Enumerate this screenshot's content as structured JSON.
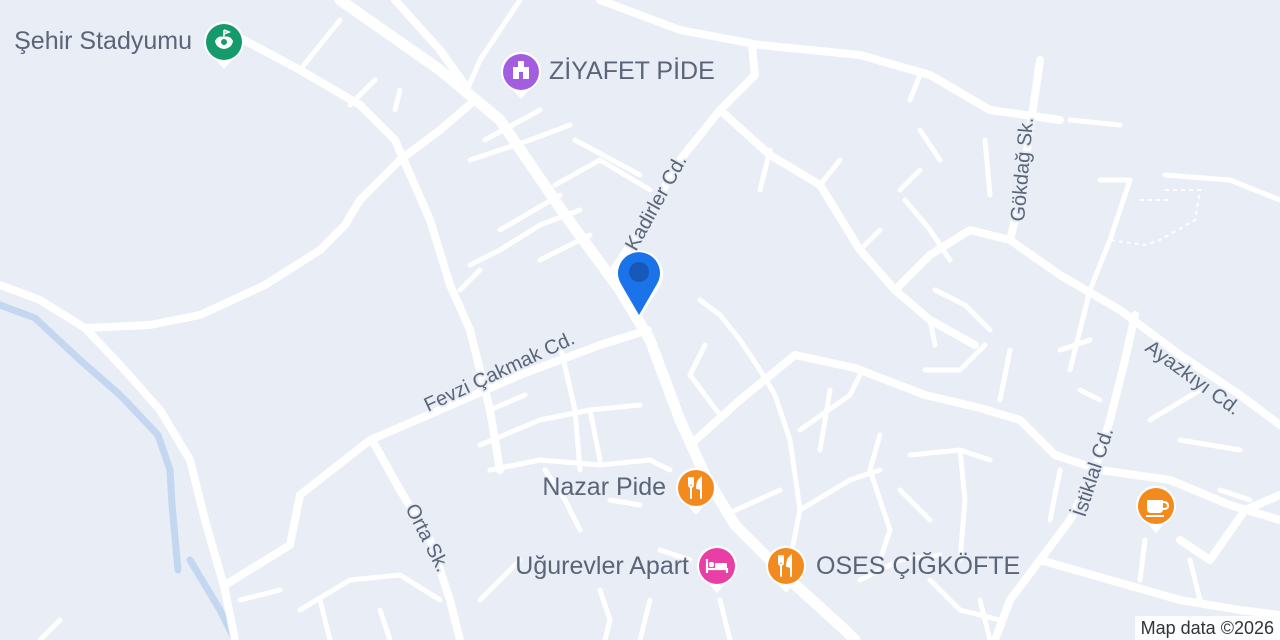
{
  "map": {
    "colors": {
      "background": "#e8edf6",
      "road": "#ffffff",
      "river": "#c3d7f1",
      "label": "#5b6578",
      "location_pin": "#1a73e8"
    },
    "streets": {
      "kadirler": "Kadirler Cd.",
      "fevzi": "Fevzi Çakmak Cd.",
      "orta": "Orta Sk.",
      "gokdag": "Gökdağ Sk.",
      "ayazkiyi": "Ayazkıyı Cd.",
      "istiklal": "İstiklal Cd."
    },
    "pois": {
      "stadium": {
        "label": "Şehir Stadyumu",
        "icon": "stadium-icon",
        "color": "#159a6b"
      },
      "ziyafet": {
        "label": "ZİYAFET PİDE",
        "icon": "bakery-icon",
        "color": "#a35ee0"
      },
      "nazar": {
        "label": "Nazar Pide",
        "icon": "fork-knife-icon",
        "color": "#f28a1e"
      },
      "ugurevler": {
        "label": "Uğurevler Apart",
        "icon": "bed-icon",
        "color": "#ea3ea7"
      },
      "oses": {
        "label": "OSES ÇİĞKÖFTE",
        "icon": "fork-knife-icon",
        "color": "#f28a1e"
      },
      "cafe": {
        "label": "",
        "icon": "coffee-cup-icon",
        "color": "#f28a1e"
      }
    },
    "attribution": "Map data ©2026"
  }
}
